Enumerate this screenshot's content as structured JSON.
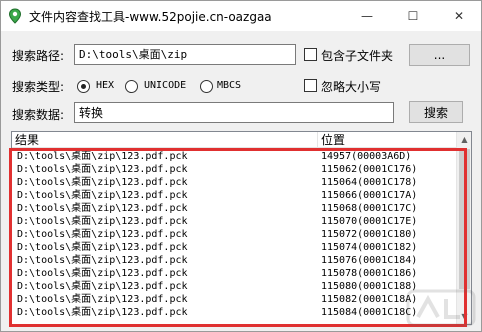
{
  "window": {
    "title": "文件内容查找工具-www.52pojie.cn-oazgaa",
    "minimize_glyph": "—",
    "maximize_glyph": "☐",
    "close_glyph": "✕"
  },
  "form": {
    "path_label": "搜索路径:",
    "path_value": "D:\\tools\\桌面\\zip",
    "include_subfolders_label": "包含子文件夹",
    "include_subfolders_checked": false,
    "browse_label": "...",
    "type_label": "搜索类型:",
    "types": [
      {
        "label": "HEX",
        "selected": true
      },
      {
        "label": "UNICODE",
        "selected": false
      },
      {
        "label": "MBCS",
        "selected": false
      }
    ],
    "ignore_case_label": "忽略大小写",
    "ignore_case_checked": false,
    "data_label": "搜索数据:",
    "data_value": "转换",
    "search_label": "搜索"
  },
  "results": {
    "columns": [
      "结果",
      "位置"
    ],
    "rows": [
      {
        "path": "D:\\tools\\桌面\\zip\\123.pdf.pck",
        "pos": "14957(00003A6D)"
      },
      {
        "path": "D:\\tools\\桌面\\zip\\123.pdf.pck",
        "pos": "115062(0001C176)"
      },
      {
        "path": "D:\\tools\\桌面\\zip\\123.pdf.pck",
        "pos": "115064(0001C178)"
      },
      {
        "path": "D:\\tools\\桌面\\zip\\123.pdf.pck",
        "pos": "115066(0001C17A)"
      },
      {
        "path": "D:\\tools\\桌面\\zip\\123.pdf.pck",
        "pos": "115068(0001C17C)"
      },
      {
        "path": "D:\\tools\\桌面\\zip\\123.pdf.pck",
        "pos": "115070(0001C17E)"
      },
      {
        "path": "D:\\tools\\桌面\\zip\\123.pdf.pck",
        "pos": "115072(0001C180)"
      },
      {
        "path": "D:\\tools\\桌面\\zip\\123.pdf.pck",
        "pos": "115074(0001C182)"
      },
      {
        "path": "D:\\tools\\桌面\\zip\\123.pdf.pck",
        "pos": "115076(0001C184)"
      },
      {
        "path": "D:\\tools\\桌面\\zip\\123.pdf.pck",
        "pos": "115078(0001C186)"
      },
      {
        "path": "D:\\tools\\桌面\\zip\\123.pdf.pck",
        "pos": "115080(0001C188)"
      },
      {
        "path": "D:\\tools\\桌面\\zip\\123.pdf.pck",
        "pos": "115082(0001C18A)"
      },
      {
        "path": "D:\\tools\\桌面\\zip\\123.pdf.pck",
        "pos": "115084(0001C18C)"
      }
    ]
  },
  "colors": {
    "highlight": "#e03030",
    "window_bg": "#f0f0f0"
  },
  "icons": {
    "app": "map-pin-icon",
    "scroll_up": "chevron-up-icon",
    "scroll_down": "chevron-down-icon"
  }
}
